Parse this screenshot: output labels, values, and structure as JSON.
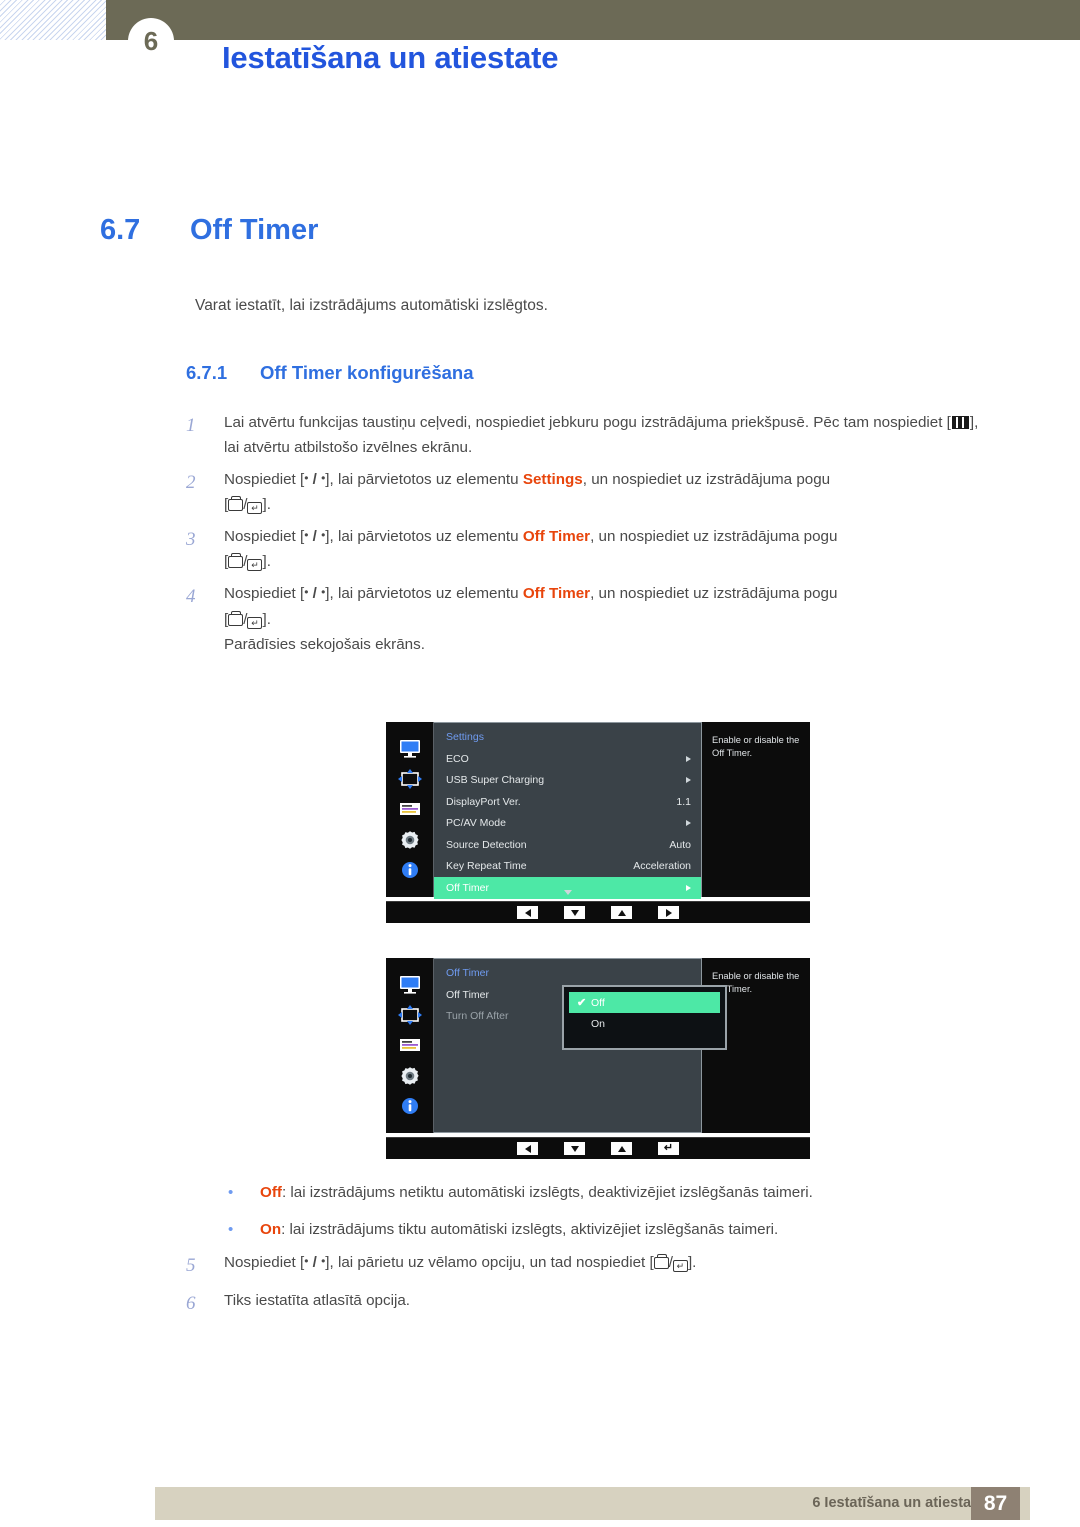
{
  "header": {
    "chapter_number": "6",
    "title": "Iestatīšana un atiestate"
  },
  "section": {
    "number": "6.7",
    "title": "Off Timer",
    "lead": "Varat iestatīt, lai izstrādājums automātiski izslēgtos.",
    "sub_number": "6.7.1",
    "sub_title": "Off Timer konfigurēšana"
  },
  "steps": [
    {
      "num": "1",
      "part1": "Lai atvērtu funkcijas taustiņu ceļvedi, nospiediet jebkuru pogu izstrādājuma priekšpusē. Pēc tam nospiediet [",
      "part2": "], lai atvērtu atbilstošo izvēlnes ekrānu."
    },
    {
      "num": "2",
      "pre": "Nospiediet [",
      "mid": "], lai pārvietotos uz elementu ",
      "target": "Settings",
      "post": ", un nospiediet uz izstrādājuma pogu",
      "keyline_pre": "[",
      "keyline_post": "]."
    },
    {
      "num": "3",
      "pre": "Nospiediet [",
      "mid": "], lai pārvietotos uz elementu ",
      "target": "Off Timer",
      "post": ", un nospiediet uz izstrādājuma pogu",
      "keyline_pre": "[",
      "keyline_post": "]."
    },
    {
      "num": "4",
      "pre": "Nospiediet [",
      "mid": "], lai pārvietotos uz elementu ",
      "target": "Off Timer",
      "post": ", un nospiediet uz izstrādājuma pogu",
      "keyline_pre": "[",
      "keyline_post": "].",
      "extra": "Parādīsies sekojošais ekrāns."
    }
  ],
  "steps_tail": [
    {
      "num": "5",
      "pre": "Nospiediet [",
      "mid": "], lai pārietu uz vēlamo opciju, un tad nospiediet [",
      "post": "]."
    },
    {
      "num": "6",
      "text": "Tiks iestatīta atlasītā opcija."
    }
  ],
  "osd_settings": {
    "title": "Settings",
    "help": "Enable or disable the Off Timer.",
    "rows": [
      {
        "label": "ECO",
        "value": "",
        "arrow": true,
        "selected": false
      },
      {
        "label": "USB Super Charging",
        "value": "",
        "arrow": true,
        "selected": false
      },
      {
        "label": "DisplayPort Ver.",
        "value": "1.1",
        "arrow": false,
        "selected": false
      },
      {
        "label": "PC/AV Mode",
        "value": "",
        "arrow": true,
        "selected": false
      },
      {
        "label": "Source Detection",
        "value": "Auto",
        "arrow": false,
        "selected": false
      },
      {
        "label": "Key Repeat Time",
        "value": "Acceleration",
        "arrow": false,
        "selected": false
      },
      {
        "label": "Off Timer",
        "value": "",
        "arrow": true,
        "selected": true
      }
    ],
    "nav": [
      "left-triangle-icon",
      "down-triangle-icon",
      "up-triangle-icon",
      "right-triangle-icon"
    ]
  },
  "osd_offtimer": {
    "title": "Off Timer",
    "help": "Enable or disable the Off Timer.",
    "rows": [
      {
        "label": "Off Timer",
        "dim": false
      },
      {
        "label": "Turn Off After",
        "dim": true
      }
    ],
    "popup": [
      {
        "label": "Off",
        "checked": true,
        "selected": true
      },
      {
        "label": "On",
        "checked": false,
        "selected": false
      }
    ],
    "nav": [
      "left-triangle-icon",
      "down-triangle-icon",
      "up-triangle-icon",
      "enter-icon"
    ]
  },
  "bullets": [
    {
      "term": "Off",
      "text": ": lai izstrādājums netiktu automātiski izslēgts, deaktivizējiet izslēgšanās taimeri."
    },
    {
      "term": "On",
      "text": ": lai izstrādājums tiktu automātiski izslēgts, aktivizējiet izslēgšanās taimeri."
    }
  ],
  "footer": {
    "text": "6 Iestatīšana un atiestate",
    "page": "87"
  },
  "colors": {
    "heading_blue": "#2f6fe0",
    "header_olive": "#6c6a56",
    "highlight_orange": "#e8450c",
    "osd_green": "#4de8a6",
    "footer_beige": "#d7d2c0",
    "footer_page_box": "#8e8173"
  }
}
